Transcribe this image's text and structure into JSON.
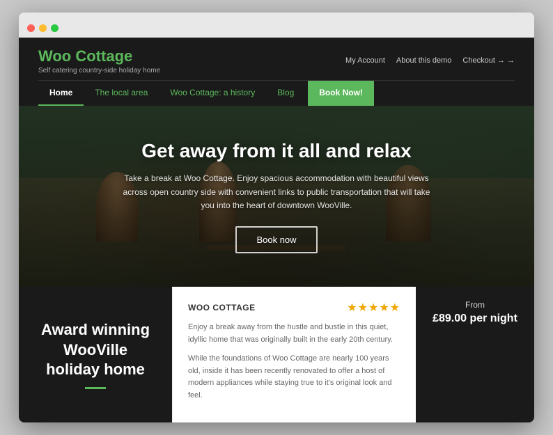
{
  "browser": {
    "dots": [
      "#ff5f57",
      "#febc2e",
      "#28c840"
    ]
  },
  "header": {
    "logo_name": "Woo Cottage",
    "logo_tagline": "Self catering country-side holiday home",
    "nav_links": [
      {
        "label": "My Account"
      },
      {
        "label": "About this demo"
      },
      {
        "label": "Checkout →"
      }
    ],
    "nav_items": [
      {
        "label": "Home",
        "active": true
      },
      {
        "label": "The local area"
      },
      {
        "label": "Woo Cottage: a history"
      },
      {
        "label": "Blog"
      },
      {
        "label": "Book Now!",
        "type": "book"
      }
    ]
  },
  "hero": {
    "title": "Get away from it all and relax",
    "subtitle": "Take a break at Woo Cottage. Enjoy spacious accommodation with beautiful views across open country side with convenient links to public transportation that will take you into the heart of downtown WooVille.",
    "button_label": "Book now"
  },
  "bottom": {
    "award_text": "Award winning WooVille holiday home",
    "card": {
      "title": "WOO COTTAGE",
      "stars": "★★★★★",
      "para1": "Enjoy a break away from the hustle and bustle in this quiet, idyllic home that was originally built in the early 20th century.",
      "para2": "While the foundations of Woo Cottage are nearly 100 years old, inside it has been recently renovated to offer a host of modern appliances while staying true to it's original look and feel."
    },
    "price": {
      "from_label": "From",
      "amount": "£89.00 per night"
    }
  }
}
